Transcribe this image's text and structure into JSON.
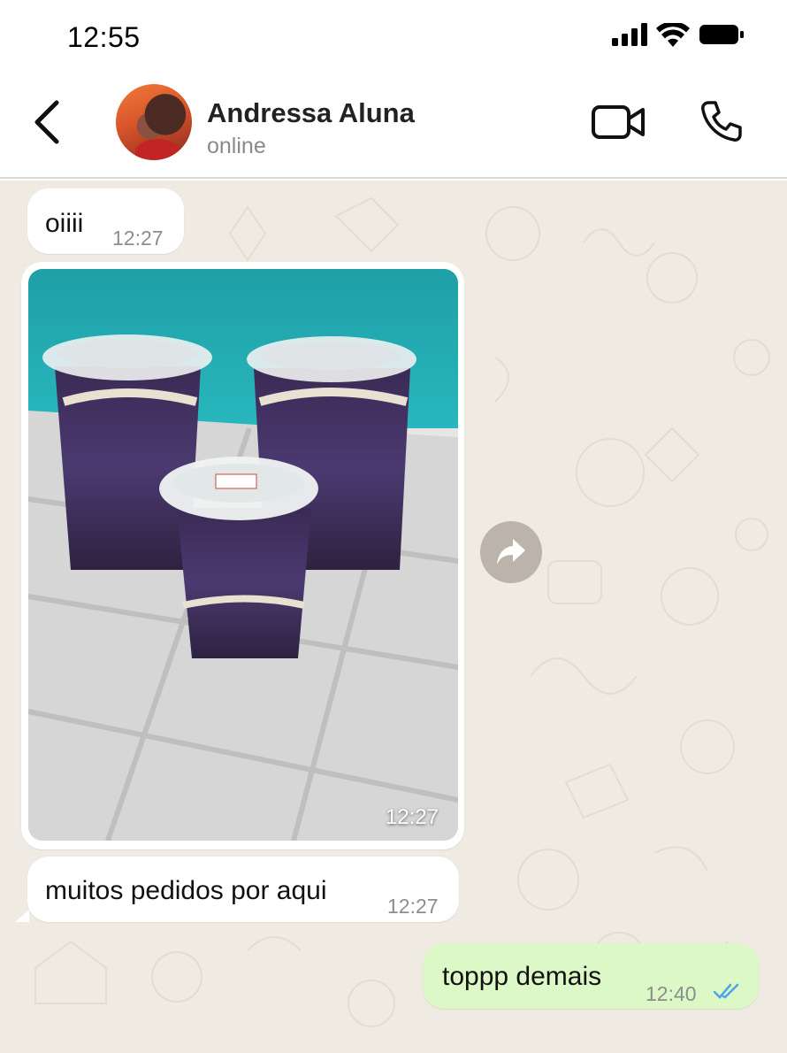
{
  "status_bar": {
    "time": "12:55",
    "icons": [
      "signal-icon",
      "wifi-icon",
      "battery-icon"
    ]
  },
  "header": {
    "contact_name": "Andressa Aluna",
    "contact_status": "online",
    "icons": [
      "back-arrow-icon",
      "video-call-icon",
      "phone-call-icon"
    ]
  },
  "messages": [
    {
      "direction": "incoming",
      "type": "text",
      "text": "oiiii",
      "time": "12:27"
    },
    {
      "direction": "incoming",
      "type": "image",
      "time": "12:27"
    },
    {
      "direction": "incoming",
      "type": "text",
      "text": "muitos pedidos por aqui",
      "time": "12:27"
    },
    {
      "direction": "outgoing",
      "type": "text",
      "text": "toppp demais",
      "time": "12:40",
      "read": true
    }
  ],
  "colors": {
    "chat_background": "#efeae2",
    "incoming_bubble": "#ffffff",
    "outgoing_bubble": "#dcf8c6",
    "read_ticks": "#4fa3e8",
    "timestamp": "#8d8d8d"
  }
}
